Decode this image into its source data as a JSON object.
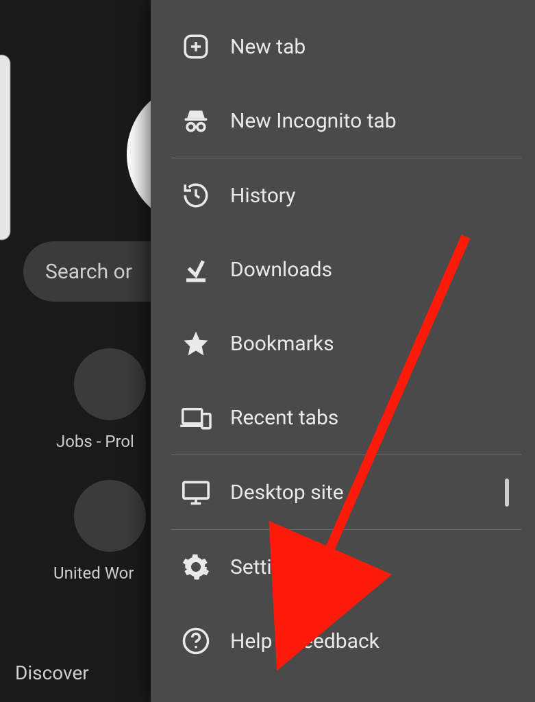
{
  "background": {
    "search_placeholder": "Search or ",
    "shortcuts": [
      {
        "label": "Jobs - Prol"
      },
      {
        "label": "United Wor"
      }
    ],
    "discover_label": "Discover"
  },
  "menu": {
    "items": [
      {
        "icon": "plus-box",
        "label": "New tab"
      },
      {
        "icon": "incognito",
        "label": "New Incognito tab"
      },
      {
        "icon": "history",
        "label": "History"
      },
      {
        "icon": "download",
        "label": "Downloads"
      },
      {
        "icon": "star",
        "label": "Bookmarks"
      },
      {
        "icon": "devices",
        "label": "Recent tabs"
      },
      {
        "icon": "monitor",
        "label": "Desktop site",
        "checkbox": true
      },
      {
        "icon": "gear",
        "label": "Settings"
      },
      {
        "icon": "help",
        "label": "Help & feedback"
      }
    ]
  },
  "annotation": {
    "arrow_color": "#ff1a0a",
    "target": "Settings"
  }
}
